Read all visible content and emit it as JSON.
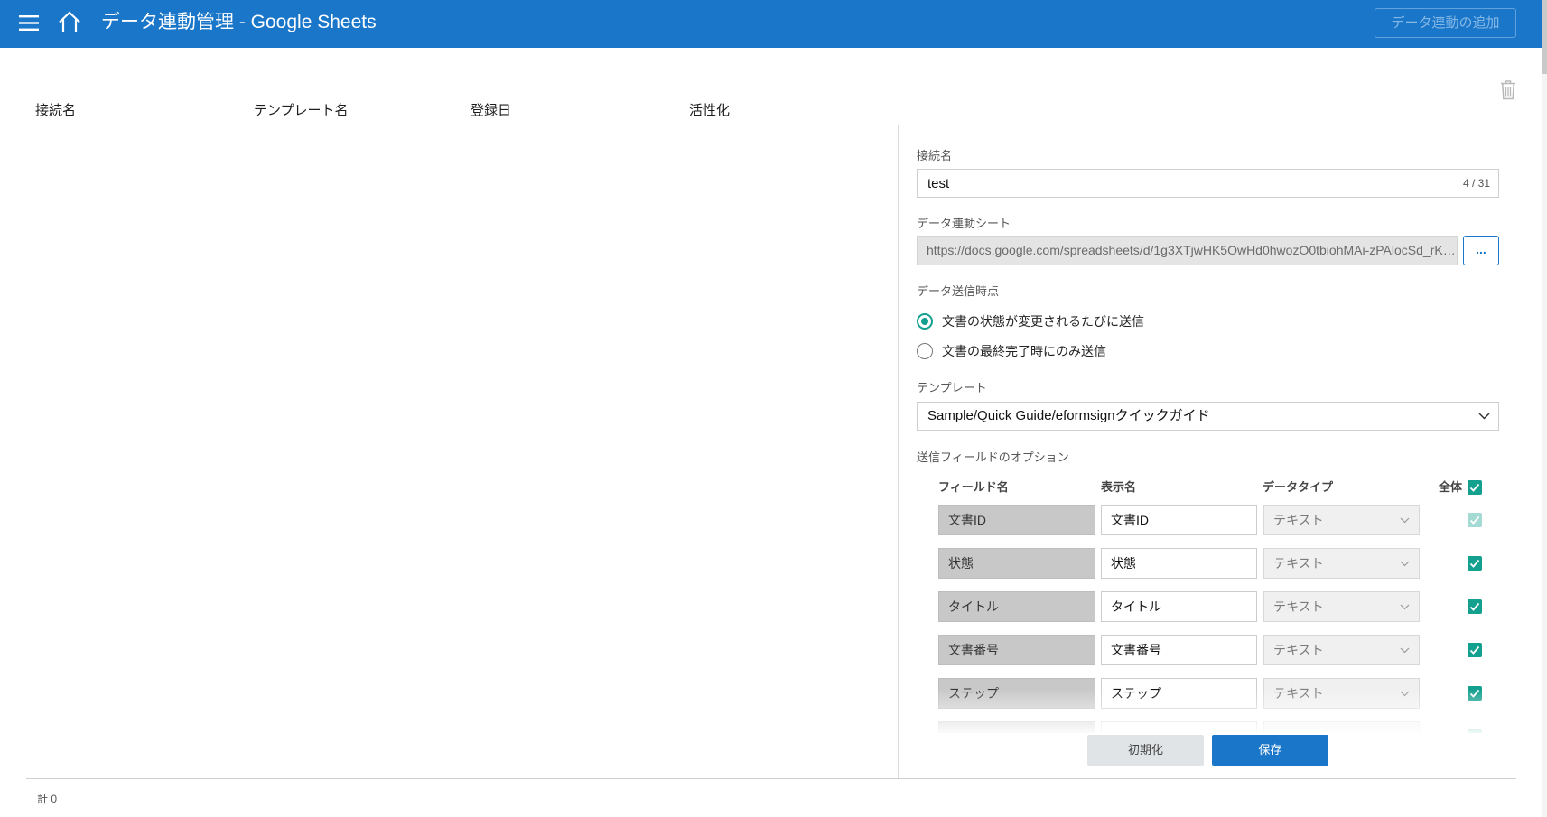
{
  "colors": {
    "header": "#1976c9",
    "accent": "#14a08f",
    "accent_disabled": "#a3dad3",
    "primary": "#1976c9"
  },
  "icons": {
    "menu": "menu-icon",
    "home": "home-icon",
    "delete": "trash-icon",
    "dropdown": "chevron-down-icon",
    "check": "checkmark-icon"
  },
  "header": {
    "title": "データ連動管理 - Google Sheets",
    "add_button": "データ連動の追加",
    "add_button_disabled": true
  },
  "list": {
    "columns": {
      "name": "接続名",
      "template": "テンプレート名",
      "registered": "登録日",
      "active": "活性化"
    },
    "total": "計 0"
  },
  "form": {
    "connection_name": {
      "label": "接続名",
      "value": "test",
      "counter": "4 / 31"
    },
    "sheet": {
      "label": "データ連動シート",
      "value": "https://docs.google.com/spreadsheets/d/1g3XTjwHK5OwHd0hwozO0tbiohMAi-zPAlocSd_rK…",
      "browse_button": "..."
    },
    "send_timing": {
      "label": "データ送信時点",
      "options": [
        {
          "label": "文書の状態が変更されるたびに送信",
          "selected": true
        },
        {
          "label": "文書の最終完了時にのみ送信",
          "selected": false
        }
      ]
    },
    "template": {
      "label": "テンプレート",
      "value": "Sample/Quick Guide/eformsignクイックガイド"
    },
    "field_options": {
      "label": "送信フィールドのオプション",
      "columns": {
        "field_name": "フィールド名",
        "display_name": "表示名",
        "data_type": "データタイプ",
        "all": "全体"
      },
      "all_checked": true,
      "rows": [
        {
          "field_name": "文書ID",
          "display_name": "文書ID",
          "data_type": "テキスト",
          "included": true,
          "locked": true
        },
        {
          "field_name": "状態",
          "display_name": "状態",
          "data_type": "テキスト",
          "included": true,
          "locked": false
        },
        {
          "field_name": "タイトル",
          "display_name": "タイトル",
          "data_type": "テキスト",
          "included": true,
          "locked": false
        },
        {
          "field_name": "文書番号",
          "display_name": "文書番号",
          "data_type": "テキスト",
          "included": true,
          "locked": false
        },
        {
          "field_name": "ステップ",
          "display_name": "ステップ",
          "data_type": "テキスト",
          "included": true,
          "locked": false
        }
      ]
    },
    "buttons": {
      "reset": "初期化",
      "save": "保存"
    }
  }
}
